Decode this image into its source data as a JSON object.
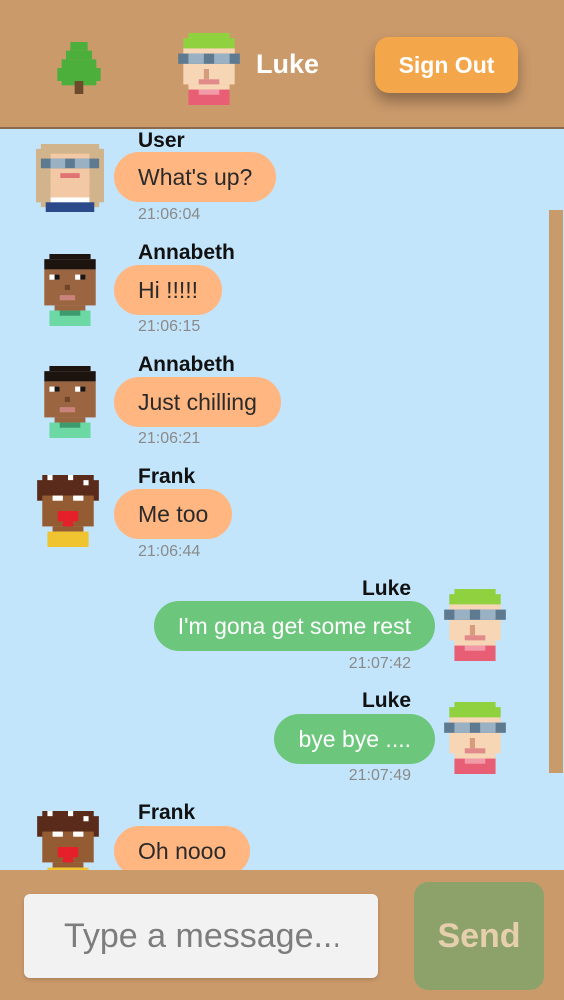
{
  "header": {
    "logo_icon": "tree-icon",
    "username": "Luke",
    "avatar_icon": "luke-avatar-icon",
    "sign_out_label": "Sign Out"
  },
  "messages": [
    {
      "sender": "User",
      "text": "What's up?",
      "time": "21:06:04",
      "avatar": "user-avatar-icon",
      "direction": "incoming"
    },
    {
      "sender": "Annabeth",
      "text": "Hi !!!!!",
      "time": "21:06:15",
      "avatar": "annabeth-avatar-icon",
      "direction": "incoming"
    },
    {
      "sender": "Annabeth",
      "text": "Just chilling",
      "time": "21:06:21",
      "avatar": "annabeth-avatar-icon",
      "direction": "incoming"
    },
    {
      "sender": "Frank",
      "text": "Me too",
      "time": "21:06:44",
      "avatar": "frank-avatar-icon",
      "direction": "incoming"
    },
    {
      "sender": "Luke",
      "text": "I'm gona get some rest",
      "time": "21:07:42",
      "avatar": "luke-avatar-icon",
      "direction": "outgoing"
    },
    {
      "sender": "Luke",
      "text": "bye bye ....",
      "time": "21:07:49",
      "avatar": "luke-avatar-icon",
      "direction": "outgoing"
    },
    {
      "sender": "Frank",
      "text": "Oh nooo",
      "time": "",
      "avatar": "frank-avatar-icon",
      "direction": "incoming"
    }
  ],
  "composer": {
    "placeholder": "Type a message...",
    "send_label": "Send"
  },
  "colors": {
    "header_bg": "#cb9a6b",
    "chat_bg": "#c2e5fb",
    "incoming_bubble": "#ffb680",
    "outgoing_bubble": "#6cc77d",
    "sign_out": "#f4a64a",
    "send_button": "#8da26b"
  }
}
